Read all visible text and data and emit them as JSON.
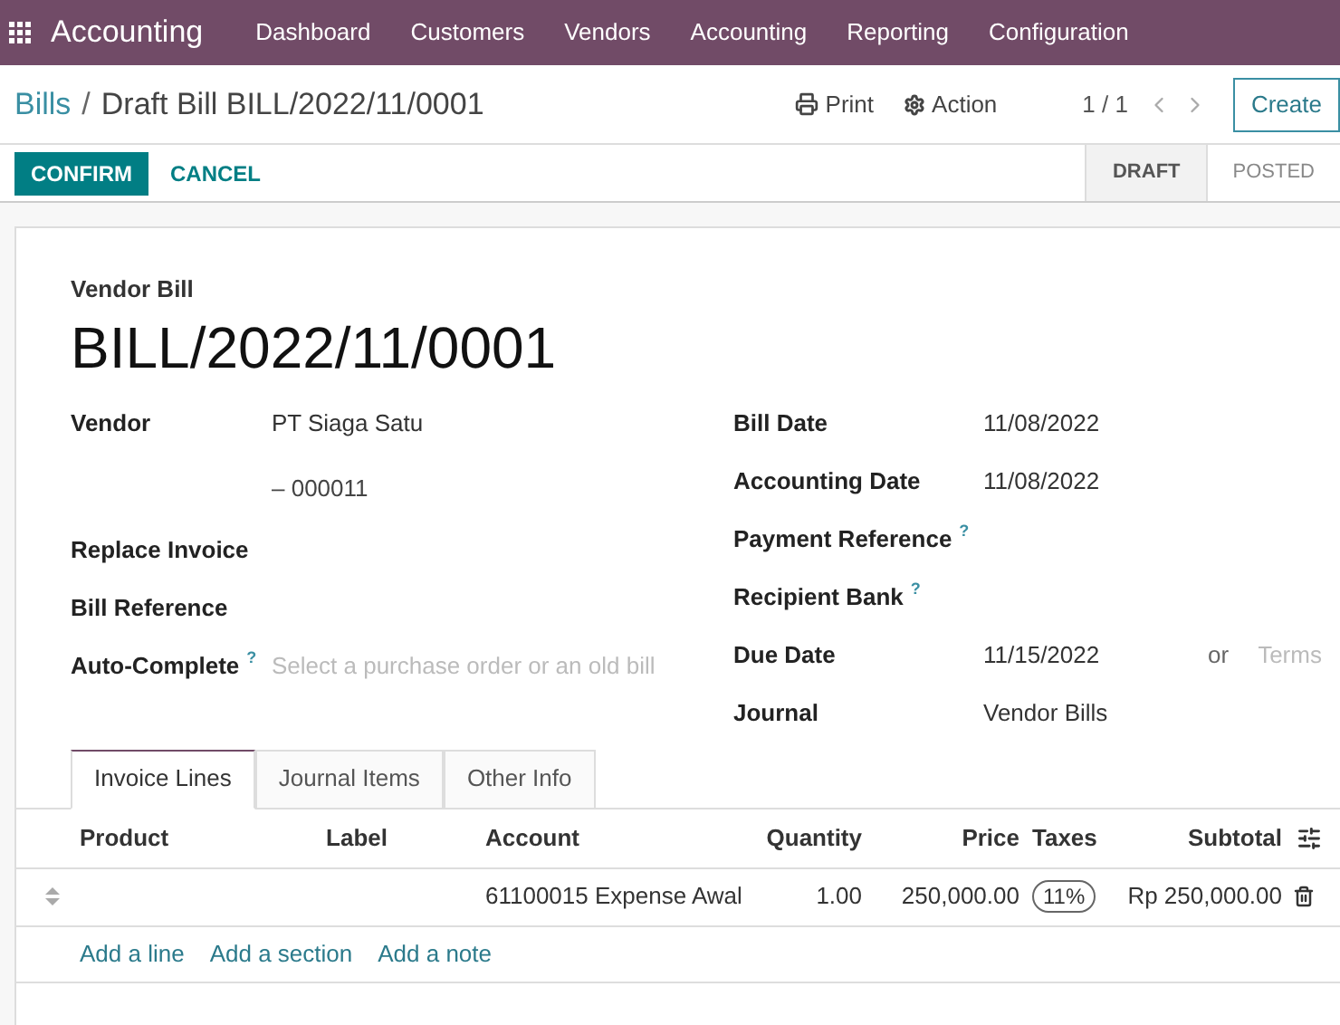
{
  "app": {
    "name": "Accounting",
    "menu": [
      "Dashboard",
      "Customers",
      "Vendors",
      "Accounting",
      "Reporting",
      "Configuration"
    ]
  },
  "breadcrumb": {
    "parent": "Bills",
    "separator": "/",
    "current": "Draft Bill BILL/2022/11/0001"
  },
  "toolbar": {
    "print": "Print",
    "action": "Action",
    "pager": "1 / 1",
    "create": "Create"
  },
  "status_bar": {
    "buttons": [
      {
        "label": "CONFIRM",
        "kind": "primary"
      },
      {
        "label": "CANCEL",
        "kind": "link"
      }
    ],
    "stages": [
      {
        "label": "DRAFT",
        "selected": true
      },
      {
        "label": "POSTED",
        "selected": false
      }
    ]
  },
  "sheet": {
    "doc_type": "Vendor Bill",
    "doc_number": "BILL/2022/11/0001",
    "left_fields": [
      {
        "label": "Vendor",
        "value": "PT Siaga Satu",
        "value_2": "– 000011"
      },
      {
        "label": "Replace Invoice"
      },
      {
        "label": "Bill Reference"
      },
      {
        "label": "Auto-Complete",
        "help": "?",
        "placeholder": "Select a purchase order or an old bill"
      }
    ],
    "right_fields": [
      {
        "label": "Bill Date",
        "value": "11/08/2022"
      },
      {
        "label": "Accounting Date",
        "value": "11/08/2022"
      },
      {
        "label": "Payment Reference",
        "help": "?"
      },
      {
        "label": "Recipient Bank",
        "help": "?"
      },
      {
        "label": "Due Date",
        "value": "11/15/2022",
        "or": "or",
        "placeholder": "Terms"
      },
      {
        "label": "Journal",
        "value": "Vendor Bills"
      }
    ],
    "tabs": [
      {
        "label": "Invoice Lines",
        "selected": true
      },
      {
        "label": "Journal Items",
        "selected": false
      },
      {
        "label": "Other Info",
        "selected": false
      }
    ],
    "table": {
      "columns": [
        "Product",
        "Label",
        "Account",
        "Quantity",
        "Price",
        "Taxes",
        "Subtotal"
      ],
      "rows": [
        {
          "account": "61100015 Expense Awal",
          "quantity": "1.00",
          "price": "250,000.00",
          "taxes": [
            "11%"
          ],
          "subtotal": "Rp 250,000.00"
        }
      ],
      "add_links": [
        "Add a line",
        "Add a section",
        "Add a note"
      ]
    }
  }
}
